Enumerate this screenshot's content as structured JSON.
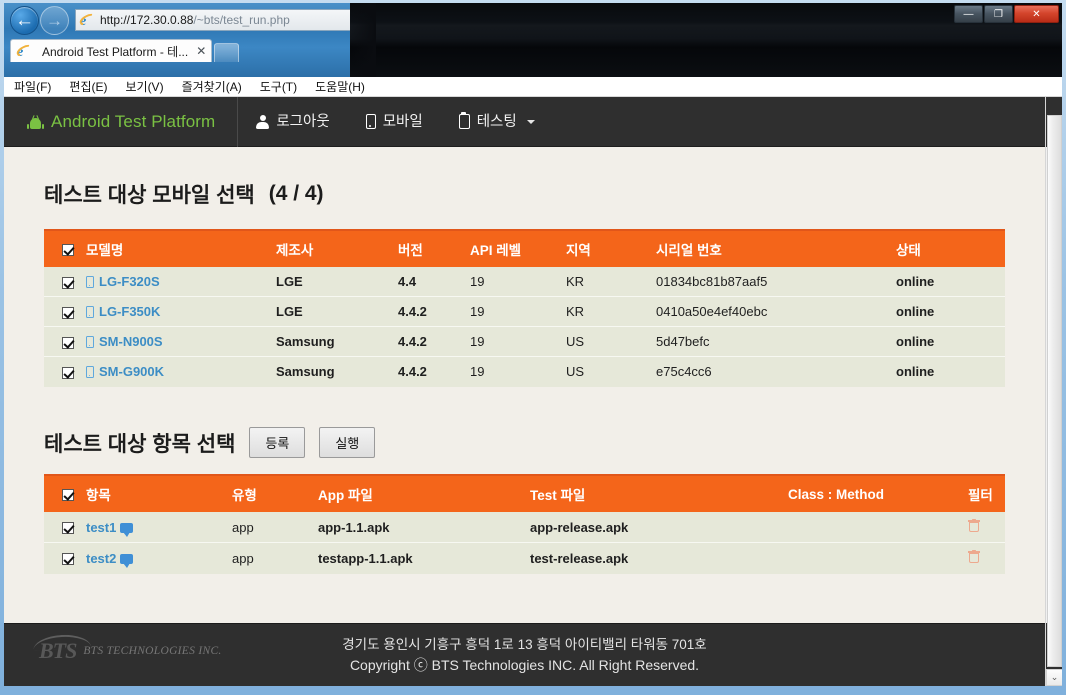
{
  "browser": {
    "url_host": "http://172.30.0.88",
    "url_path": "/~bts/test_run.php",
    "tab_title": "Android Test Platform - 테...",
    "tab_close": "✕",
    "back_glyph": "←",
    "forward_glyph": "→",
    "search_glyph": "⌕",
    "search_caret": "▾",
    "refresh_glyph": "⟳",
    "home_glyph": "⌂",
    "favorites_glyph": "★",
    "tools_glyph": "⚙",
    "minimize_glyph": "—",
    "maximize_glyph": "❐",
    "close_glyph": "✕",
    "menus": [
      "파일(F)",
      "편집(E)",
      "보기(V)",
      "즐겨찾기(A)",
      "도구(T)",
      "도움말(H)"
    ]
  },
  "sitenav": {
    "brand": "Android Test Platform",
    "links": [
      {
        "label": "로그아웃",
        "icon": "user-icon"
      },
      {
        "label": "모바일",
        "icon": "mobile-icon"
      },
      {
        "label": "테스팅",
        "icon": "clipboard-icon",
        "caret": true
      }
    ]
  },
  "devices_section": {
    "title": "테스트 대상 모바일 선택",
    "count": "(4 / 4)",
    "headers": [
      "모델명",
      "제조사",
      "버전",
      "API 레벨",
      "지역",
      "시리얼 번호",
      "상태"
    ],
    "rows": [
      {
        "model": "LG-F320S",
        "maker": "LGE",
        "version": "4.4",
        "api": "19",
        "region": "KR",
        "serial": "01834bc81b87aaf5",
        "status": "online"
      },
      {
        "model": "LG-F350K",
        "maker": "LGE",
        "version": "4.4.2",
        "api": "19",
        "region": "KR",
        "serial": "0410a50e4ef40ebc",
        "status": "online"
      },
      {
        "model": "SM-N900S",
        "maker": "Samsung",
        "version": "4.4.2",
        "api": "19",
        "region": "US",
        "serial": "5d47befc",
        "status": "online"
      },
      {
        "model": "SM-G900K",
        "maker": "Samsung",
        "version": "4.4.2",
        "api": "19",
        "region": "US",
        "serial": "e75c4cc6",
        "status": "online"
      }
    ]
  },
  "tests_section": {
    "title": "테스트 대상 항목 선택",
    "buttons": {
      "register": "등록",
      "run": "실행"
    },
    "headers": [
      "항목",
      "유형",
      "App 파일",
      "Test 파일",
      "Class : Method",
      "필터"
    ],
    "rows": [
      {
        "name": "test1",
        "type": "app",
        "app_file": "app-1.1.apk",
        "test_file": "app-release.apk",
        "class_method": "",
        "filter": ""
      },
      {
        "name": "test2",
        "type": "app",
        "app_file": "testapp-1.1.apk",
        "test_file": "test-release.apk",
        "class_method": "",
        "filter": ""
      }
    ]
  },
  "footer": {
    "logo_mark": "BTS",
    "logo_word": "BTS TECHNOLOGIES INC.",
    "address": "경기도 용인시 기흥구 흥덕 1로 13 흥덕 아이티밸리 타워동 701호",
    "copyright": "Copyright ⓒ BTS Technologies INC. All Right Reserved."
  },
  "scrollbar": {
    "up": "⌃",
    "down": "⌄"
  },
  "colors": {
    "brand_green": "#7ac143",
    "table_header_orange": "#f4651a",
    "status_green": "#1a9a1a",
    "link_blue": "#3c8dc5",
    "navbar_dark": "#2f2f2f",
    "content_bg": "#f2efe9",
    "row_bg": "#e6e8d9"
  }
}
